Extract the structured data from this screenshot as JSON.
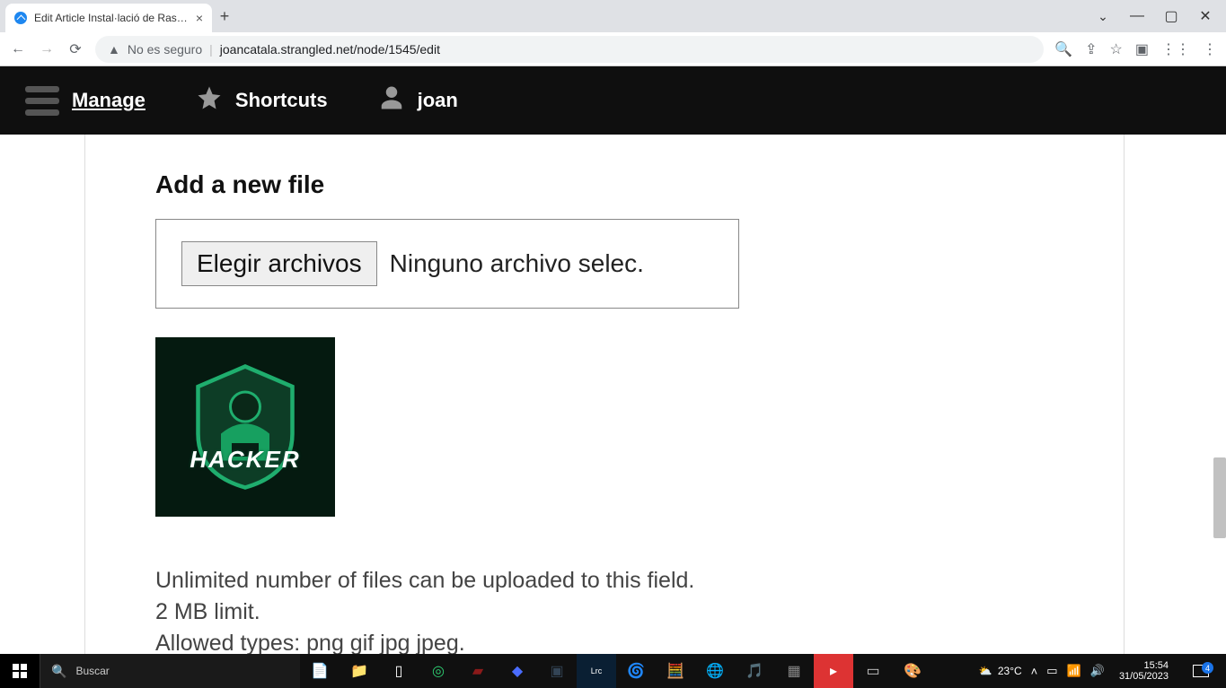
{
  "browser": {
    "tab_title": "Edit Article Instal·lació de Raspbi",
    "security_label": "No es seguro",
    "url": "joancatala.strangled.net/node/1545/edit"
  },
  "admin": {
    "manage": "Manage",
    "shortcuts": "Shortcuts",
    "user": "joan"
  },
  "content": {
    "heading": "Add a new file",
    "choose_button": "Elegir archivos",
    "no_file_text": "Ninguno archivo selec.",
    "thumb_label": "HACKER",
    "help_line1": "Unlimited number of files can be uploaded to this field.",
    "help_line2": "2 MB limit.",
    "help_line3": "Allowed types: png gif jpg jpeg."
  },
  "taskbar": {
    "search_placeholder": "Buscar",
    "weather_temp": "23°C",
    "time": "15:54",
    "date": "31/05/2023",
    "notif_count": "4"
  }
}
